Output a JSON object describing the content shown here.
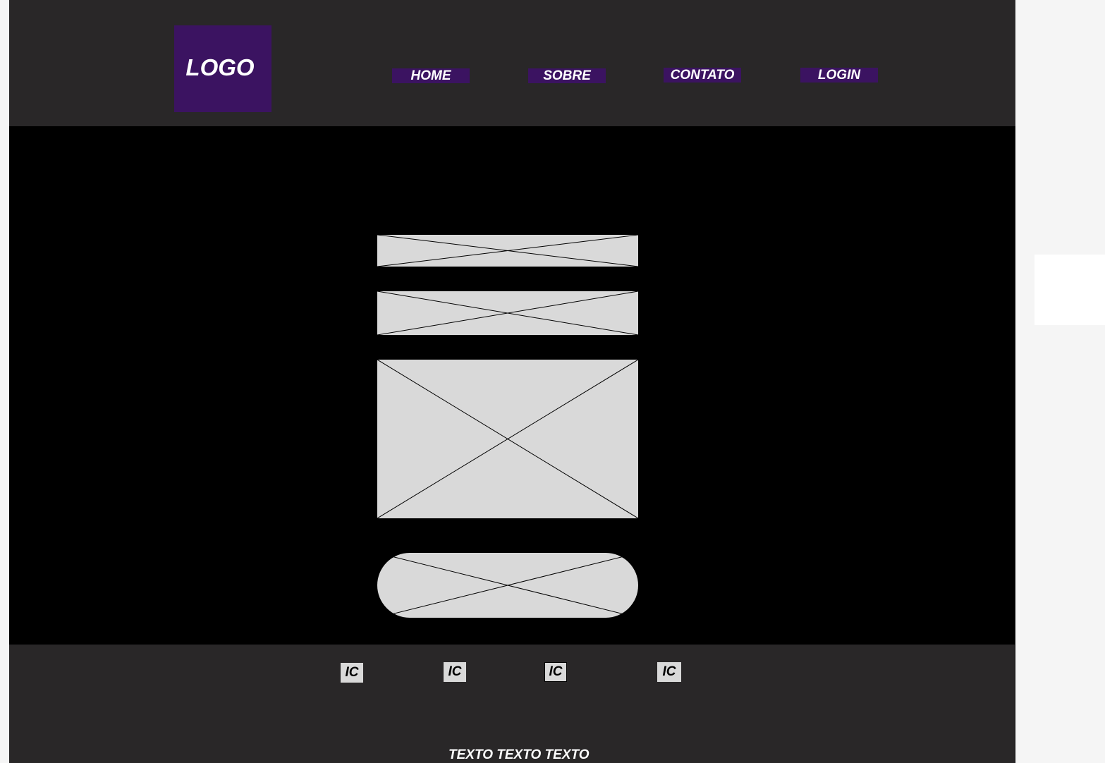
{
  "header": {
    "logo": "LOGO",
    "nav": [
      {
        "label": "HOME"
      },
      {
        "label": "SOBRE"
      },
      {
        "label": "CONTATO"
      },
      {
        "label": "LOGIN"
      }
    ]
  },
  "footer": {
    "icons": [
      {
        "label": "IC"
      },
      {
        "label": "IC"
      },
      {
        "label": "IC"
      },
      {
        "label": "IC"
      }
    ],
    "text": "TEXTO TEXTO TEXTO"
  },
  "colors": {
    "header_bg": "#292728",
    "accent": "#3b1361",
    "main_bg": "#000000",
    "placeholder": "#d9d9d9"
  }
}
